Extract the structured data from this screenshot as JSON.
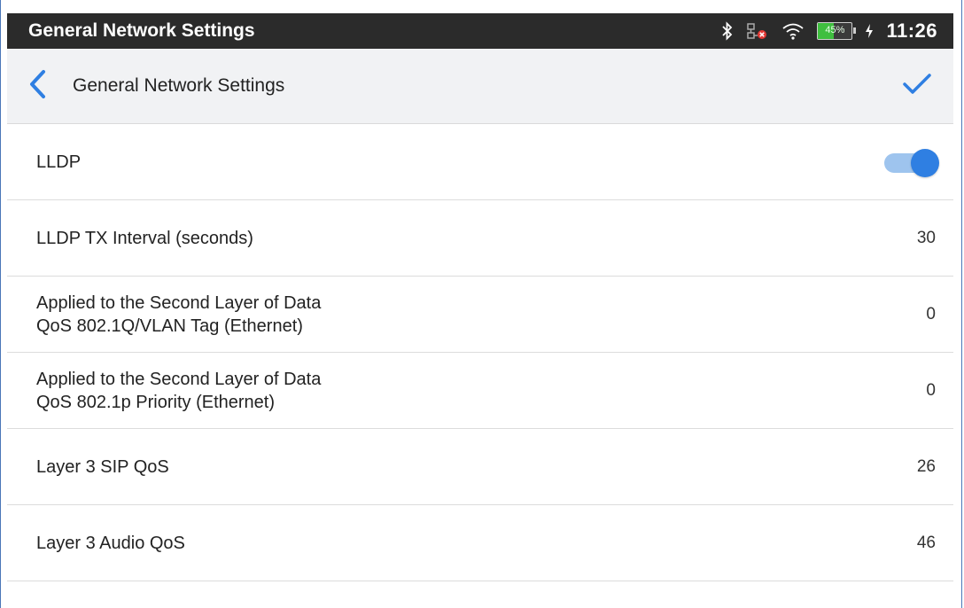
{
  "statusbar": {
    "title": "General Network Settings",
    "battery_percent": "45%",
    "battery_level": 0.45,
    "time": "11:26",
    "icons": [
      "bluetooth-icon",
      "network-disconnected-icon",
      "wifi-icon",
      "battery-icon",
      "charging-icon"
    ]
  },
  "header": {
    "title": "General Network Settings",
    "back_icon": "chevron-left-icon",
    "confirm_icon": "checkmark-icon"
  },
  "colors": {
    "accent": "#2f7fe2",
    "statusbar_bg": "#2b2b2b",
    "header_bg": "#f1f2f4",
    "toggle_track": "#9ec4ee"
  },
  "settings": [
    {
      "label": "LLDP",
      "type": "toggle",
      "enabled": true
    },
    {
      "label": "LLDP TX Interval (seconds)",
      "value": "30"
    },
    {
      "label_line1": "Applied to the Second Layer of Data",
      "label_line2": "QoS 802.1Q/VLAN Tag (Ethernet)",
      "value": "0"
    },
    {
      "label_line1": "Applied to the Second Layer of Data",
      "label_line2": "QoS 802.1p Priority (Ethernet)",
      "value": "0"
    },
    {
      "label": "Layer 3 SIP QoS",
      "value": "26"
    },
    {
      "label": "Layer 3 Audio QoS",
      "value": "46"
    }
  ]
}
